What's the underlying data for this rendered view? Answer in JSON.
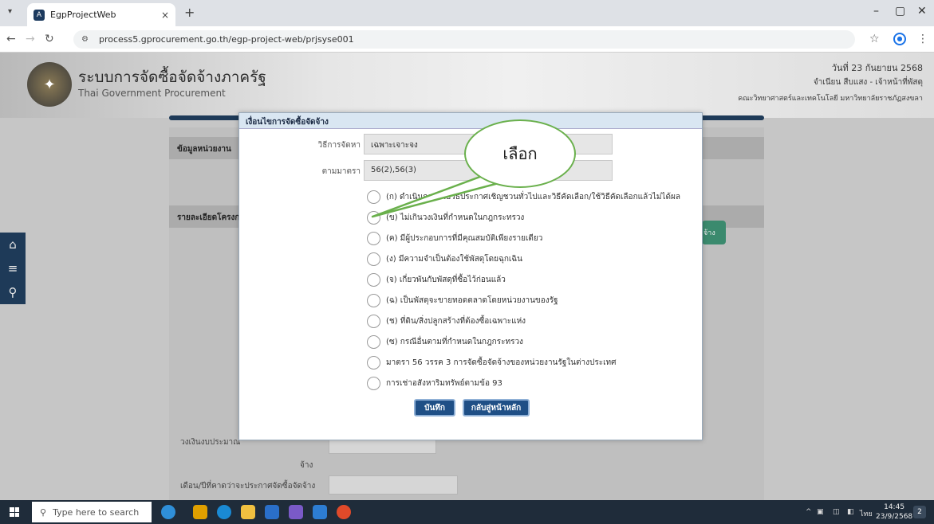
{
  "browser": {
    "tab_title": "EgpProjectWeb",
    "tab_close": "×",
    "new_tab": "+",
    "url": "process5.gprocurement.go.th/egp-project-web/prjsyse001",
    "minimize": "–",
    "maximize": "▢",
    "close": "✕"
  },
  "header": {
    "system_name": "ระบบการจัดซื้อจัดจ้างภาครัฐ",
    "system_subtitle": "Thai Government Procurement",
    "date": "วันที่ 23 กันยายน 2568",
    "user": "จำเนียน สืบแสง - เจ้าหน้าที่พัสดุ",
    "org": "คณะวิทยาศาสตร์และเทคโนโลยี มหาวิทยาลัยราชภัฏสงขลา"
  },
  "page": {
    "section_agency": "ข้อมูลหน่วยงาน",
    "section_project": "รายละเอียดโครงการ",
    "label_budget": "วงเงินงบประมาณ",
    "label_budget_suffix": "จ้าง",
    "label_month": "เดือน/ปีที่คาดว่าจะประกาศจัดซื้อจัดจ้าง",
    "green_button": "จ้าง"
  },
  "modal": {
    "title": "เงื่อนไขการจัดซื้อจัดจ้าง",
    "method_label": "วิธีการจัดหา",
    "method_value": "เฉพาะเจาะจง",
    "section_label": "ตามมาตรา",
    "section_value": "56(2),56(3)",
    "options": [
      "(ก) ดำเนินการด้วยวิธีประกาศเชิญชวนทั่วไปและวิธีคัดเลือก/ใช้วิธีคัดเลือกแล้วไม่ได้ผล",
      "(ข) ไม่เกินวงเงินที่กำหนดในกฎกระทรวง",
      "(ค) มีผู้ประกอบการที่มีคุณสมบัติเพียงรายเดียว",
      "(ง) มีความจำเป็นต้องใช้พัสดุโดยฉุกเฉิน",
      "(จ) เกี่ยวพันกับพัสดุที่ซื้อไว้ก่อนแล้ว",
      "(ฉ) เป็นพัสดุจะขายทอดตลาดโดยหน่วยงานของรัฐ",
      "(ช) ที่ดิน/สิ่งปลูกสร้างที่ต้องซื้อเฉพาะแห่ง",
      "(ซ) กรณีอื่นตามที่กำหนดในกฎกระทรวง",
      "มาตรา 56 วรรค 3 การจัดซื้อจัดจ้างของหน่วยงานรัฐในต่างประเทศ",
      "การเช่าอสังหาริมทรัพย์ตามข้อ 93"
    ],
    "save_label": "บันทึก",
    "back_label": "กลับสู่หน้าหลัก"
  },
  "annotation": {
    "callout_text": "เลือก"
  },
  "taskbar": {
    "search_placeholder": "Type here to search",
    "lang": "ไทย",
    "time": "14:45",
    "date": "23/9/2568",
    "notif_count": "2"
  }
}
